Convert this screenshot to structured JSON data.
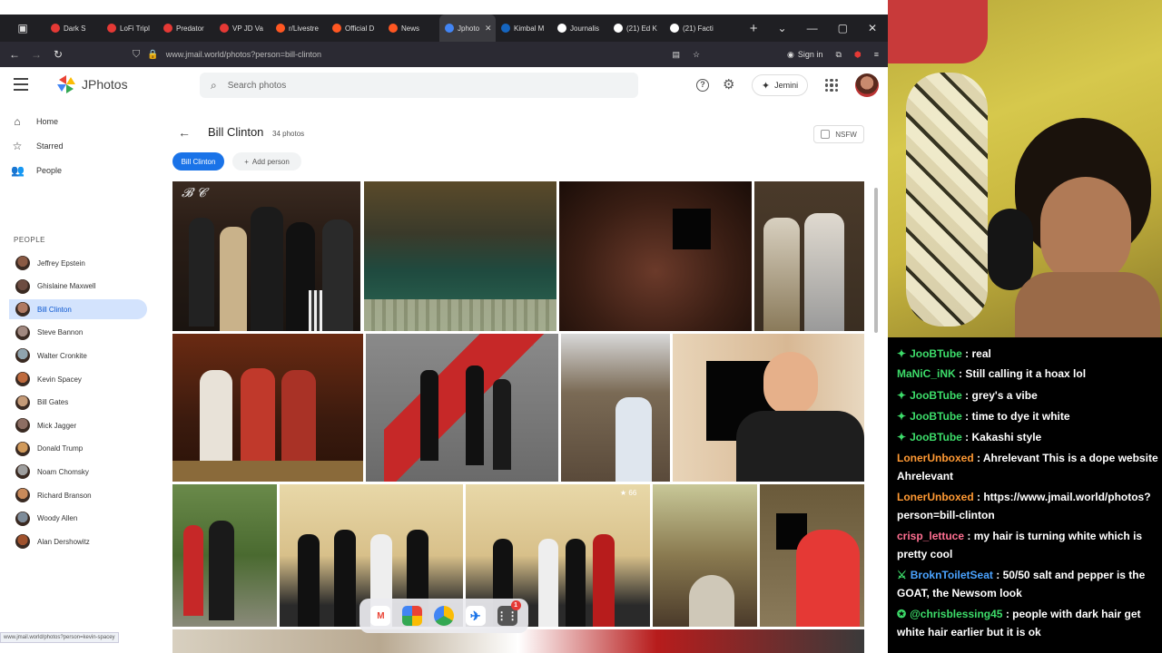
{
  "browser": {
    "tabs": [
      {
        "label": "Dark S",
        "color": "#e53935"
      },
      {
        "label": "LoFi Tripl",
        "color": "#e53935"
      },
      {
        "label": "Predator",
        "color": "#e53935"
      },
      {
        "label": "VP JD Va",
        "color": "#e53935"
      },
      {
        "label": "r/Livestre",
        "color": "#ff5722"
      },
      {
        "label": "Official D",
        "color": "#ff5722"
      },
      {
        "label": "News",
        "color": "#ff5722"
      },
      {
        "label": "Jphoto",
        "color": "#4285f4",
        "active": true
      },
      {
        "label": "Kimbal M",
        "color": "#1565c0"
      },
      {
        "label": "Journalis",
        "color": "#ffffff"
      },
      {
        "label": "(21) Ed K",
        "color": "#ffffff"
      },
      {
        "label": "(21) Facti",
        "color": "#ffffff"
      }
    ],
    "url": "www.jmail.world/photos?person=bill-clinton",
    "sign_in": "Sign in",
    "status_url": "www.jmail.world/photos?person=kevin-spacey"
  },
  "app": {
    "title": "JPhotos",
    "search_placeholder": "Search photos",
    "gemini_label": "Jemini"
  },
  "nav": {
    "home": "Home",
    "starred": "Starred",
    "people": "People"
  },
  "people_heading": "PEOPLE",
  "people": [
    {
      "name": "Jeffrey Epstein",
      "color": "#8a5a44"
    },
    {
      "name": "Ghislaine Maxwell",
      "color": "#6d4c41"
    },
    {
      "name": "Bill Clinton",
      "color": "#b07a63",
      "active": true
    },
    {
      "name": "Steve Bannon",
      "color": "#a1887f"
    },
    {
      "name": "Walter Cronkite",
      "color": "#90a4ae"
    },
    {
      "name": "Kevin Spacey",
      "color": "#bf6a3d"
    },
    {
      "name": "Bill Gates",
      "color": "#c49a77"
    },
    {
      "name": "Mick Jagger",
      "color": "#8d6e63"
    },
    {
      "name": "Donald Trump",
      "color": "#d19a5b"
    },
    {
      "name": "Noam Chomsky",
      "color": "#9e9e9e"
    },
    {
      "name": "Richard Branson",
      "color": "#c98a5a"
    },
    {
      "name": "Woody Allen",
      "color": "#7e8c9a"
    },
    {
      "name": "Alan Dershowitz",
      "color": "#a0522d"
    }
  ],
  "main": {
    "person_title": "Bill Clinton",
    "photo_count": "34 photos",
    "nsfw_label": "NSFW",
    "active_chip": "Bill Clinton",
    "add_person": "Add person",
    "star_count": "66"
  },
  "dock": {
    "badge": "1"
  },
  "chat": [
    {
      "user": "JooBTube",
      "color": "#3ddc6a",
      "text": "real",
      "badge": "✦"
    },
    {
      "user": "MaNiC_iNK",
      "color": "#3ddc6a",
      "text": "Still calling it a hoax lol",
      "badge": ""
    },
    {
      "user": "JooBTube",
      "color": "#3ddc6a",
      "text": "grey's a vibe",
      "badge": "✦"
    },
    {
      "user": "JooBTube",
      "color": "#3ddc6a",
      "text": "time to dye it white",
      "badge": "✦"
    },
    {
      "user": "JooBTube",
      "color": "#3ddc6a",
      "text": "Kakashi style",
      "badge": "✦"
    },
    {
      "user": "LonerUnboxed",
      "color": "#ff9933",
      "text": "Ahrelevant This is a dope website Ahrelevant",
      "badge": ""
    },
    {
      "user": "LonerUnboxed",
      "color": "#ff9933",
      "text": "https://www.jmail.world/photos?person=bill-clinton",
      "badge": ""
    },
    {
      "user": "crisp_lettuce",
      "color": "#ff6f91",
      "text": "my hair is turning white which is pretty cool",
      "badge": ""
    },
    {
      "user": "BroknToiletSeat",
      "color": "#4aa3ff",
      "text": "50/50 salt and pepper is the GOAT, the Newsom look",
      "badge": "⚔"
    },
    {
      "user": "@chrisblessing45",
      "color": "#3ddc6a",
      "text": "people with dark hair get white hair earlier but it is ok",
      "badge": "✪"
    }
  ]
}
